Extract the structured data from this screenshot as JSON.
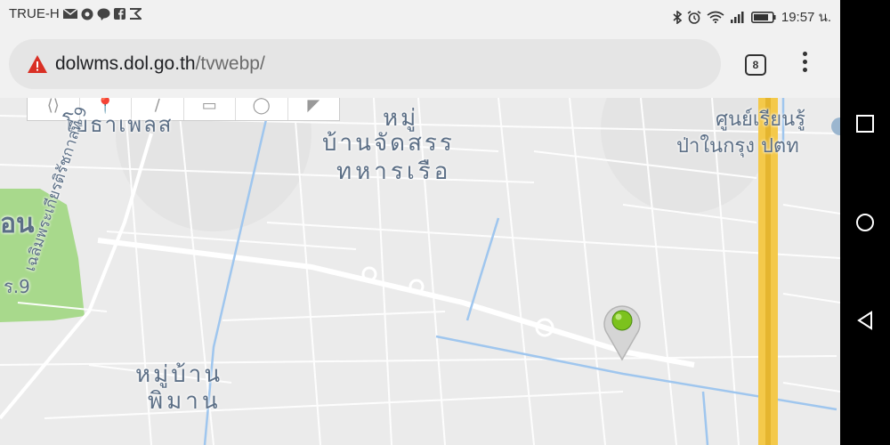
{
  "status_bar": {
    "carrier": "TRUE-H",
    "time": "19:57 น.",
    "left_icons": [
      "mail-icon",
      "chrome-icon",
      "line-icon",
      "facebook-icon",
      "cast-icon"
    ],
    "right_icons": [
      "bluetooth-icon",
      "alarm-icon",
      "wifi-icon",
      "signal-icon",
      "battery-icon"
    ]
  },
  "browser": {
    "url_host": "dolwms.dol.go.th",
    "url_path": "/tvwebp/",
    "security_icon": "warning-icon",
    "tab_count": "8",
    "menu_icon": "kebab-menu-icon"
  },
  "map": {
    "labels": {
      "top_left_partial": "โยธาเพลส",
      "village_line1": "หมู่",
      "village_line2": "บ้านจัดสรร",
      "village_line3": "ทหารเรือ",
      "center_line1": "ศูนย์เรียนรู้",
      "center_line2": "ป่าในกรุง ปตท",
      "left_partial": "อน",
      "soi": "ร.9",
      "road": "ถนน เฉลิมพระเกียรติ ร.9",
      "soi_name": "เฉลิมพระเกียรติรัชกาลที่ 9",
      "pimarn_line1": "หมู่บ้าน",
      "pimarn_line2": "พิมาน"
    },
    "toolbar_tools": [
      "pan-tool-icon",
      "pin-tool-icon",
      "line-tool-icon",
      "rect-tool-icon",
      "circle-tool-icon",
      "flag-tool-icon"
    ],
    "marker_color": "#7cc21d"
  },
  "nav": {
    "buttons": [
      "recent-apps-icon",
      "home-icon",
      "back-icon"
    ]
  }
}
